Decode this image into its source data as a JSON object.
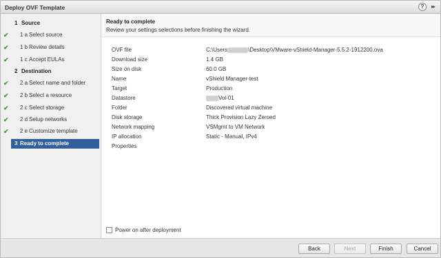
{
  "window": {
    "title": "Deploy OVF Template"
  },
  "steps": [
    {
      "num": "1",
      "label": "Source"
    },
    {
      "num": "1 a",
      "label": "Select source"
    },
    {
      "num": "1 b",
      "label": "Review details"
    },
    {
      "num": "1 c",
      "label": "Accept EULAs"
    },
    {
      "num": "2",
      "label": "Destination"
    },
    {
      "num": "2 a",
      "label": "Select name and folder"
    },
    {
      "num": "2 b",
      "label": "Select a resource"
    },
    {
      "num": "2 c",
      "label": "Select storage"
    },
    {
      "num": "2 d",
      "label": "Setup networks"
    },
    {
      "num": "2 e",
      "label": "Customize template"
    },
    {
      "num": "3",
      "label": "Ready to complete"
    }
  ],
  "content": {
    "title": "Ready to complete",
    "subtitle": "Review your settings selections before finishing the wizard."
  },
  "summary": [
    {
      "key": "OVF file",
      "value_prefix": "C:\\Users",
      "value_suffix": "\\Desktop\\VMware-vShield-Manager-5.5.2-1912200.ova"
    },
    {
      "key": "Download size",
      "value": "1.4 GB"
    },
    {
      "key": "Size on disk",
      "value": "60.0 GB"
    },
    {
      "key": "Name",
      "value": "vShield Manager-test"
    },
    {
      "key": "Target",
      "value": "Production"
    },
    {
      "key": "Datastore",
      "value_suffix": "Vol-01"
    },
    {
      "key": "Folder",
      "value": "Discovered virtual machine"
    },
    {
      "key": "Disk storage",
      "value": "Thick Provision Lazy Zeroed"
    },
    {
      "key": "Network mapping",
      "value": "VSMgmt to VM Network"
    },
    {
      "key": "IP allocation",
      "value": "Static - Manual, IPv4"
    },
    {
      "key": "Properties",
      "value": ""
    }
  ],
  "options": {
    "power_on_label": "Power on after deployment",
    "power_on_checked": false
  },
  "buttons": {
    "back": "Back",
    "next": "Next",
    "finish": "Finish",
    "cancel": "Cancel"
  },
  "colors": {
    "active_step": "#315f9c",
    "check": "#3f9a2f"
  }
}
